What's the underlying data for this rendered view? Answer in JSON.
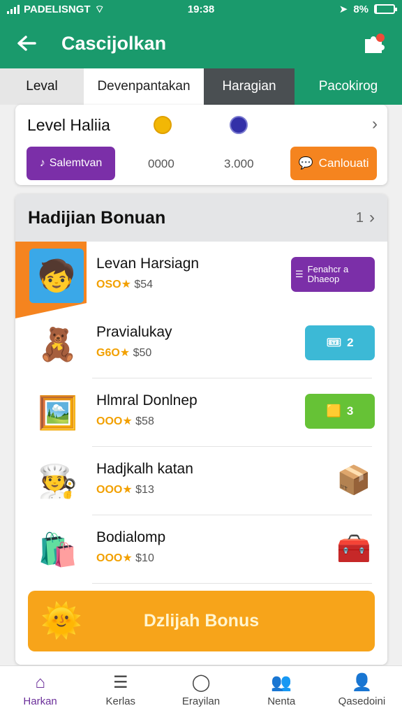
{
  "status_bar": {
    "carrier": "PADELISNGT",
    "time": "19:38",
    "battery": "8%",
    "battery_level": 0.08
  },
  "app_bar": {
    "title": "Cascijolkan",
    "back_icon": "arrow-left-icon",
    "menu_icon": "puzzle-icon"
  },
  "tabs": [
    {
      "label": "Leval"
    },
    {
      "label": "Devenpantakan"
    },
    {
      "label": "Haragian"
    },
    {
      "label": "Pacokirog"
    }
  ],
  "level_card": {
    "title": "Level Haliia",
    "value_1": "0000",
    "value_2": "3.000",
    "left_button": "Salemtvan",
    "right_button": "Canlouati"
  },
  "bonus": {
    "title": "Hadijian Bonuan",
    "count": "1",
    "items": [
      {
        "name": "Levan Harsiagn",
        "coins": "OSO",
        "price": "$54",
        "action": "Fenahcr a Dhaeop",
        "emoji": "🧒"
      },
      {
        "name": "Pravialukay",
        "coins": "G6O",
        "price": "$50",
        "action": "2",
        "emoji": "🧸"
      },
      {
        "name": "Hlmral Donlnep",
        "coins": "OOO",
        "price": "$58",
        "action": "3",
        "emoji": "🖼️"
      },
      {
        "name": "Hadjkalh katan",
        "coins": "OOO",
        "price": "$13",
        "action": "",
        "emoji": "🧑‍🍳"
      },
      {
        "name": "Bodialomp",
        "coins": "OOO",
        "price": "$10",
        "action": "",
        "emoji": "🛍️"
      }
    ],
    "cta": "Dzlijah Bonus"
  },
  "nav": [
    {
      "label": "Harkan",
      "icon": "home-icon"
    },
    {
      "label": "Kerlas",
      "icon": "list-icon"
    },
    {
      "label": "Erayilan",
      "icon": "chat-icon"
    },
    {
      "label": "Nenta",
      "icon": "people-icon"
    },
    {
      "label": "Qasedoini",
      "icon": "profile-icon"
    }
  ],
  "colors": {
    "primary": "#1a9a6c",
    "purple": "#7b2fa8",
    "orange": "#f5841f",
    "cyan": "#3cb9d6",
    "green": "#66c236",
    "cta": "#f7a41a"
  }
}
